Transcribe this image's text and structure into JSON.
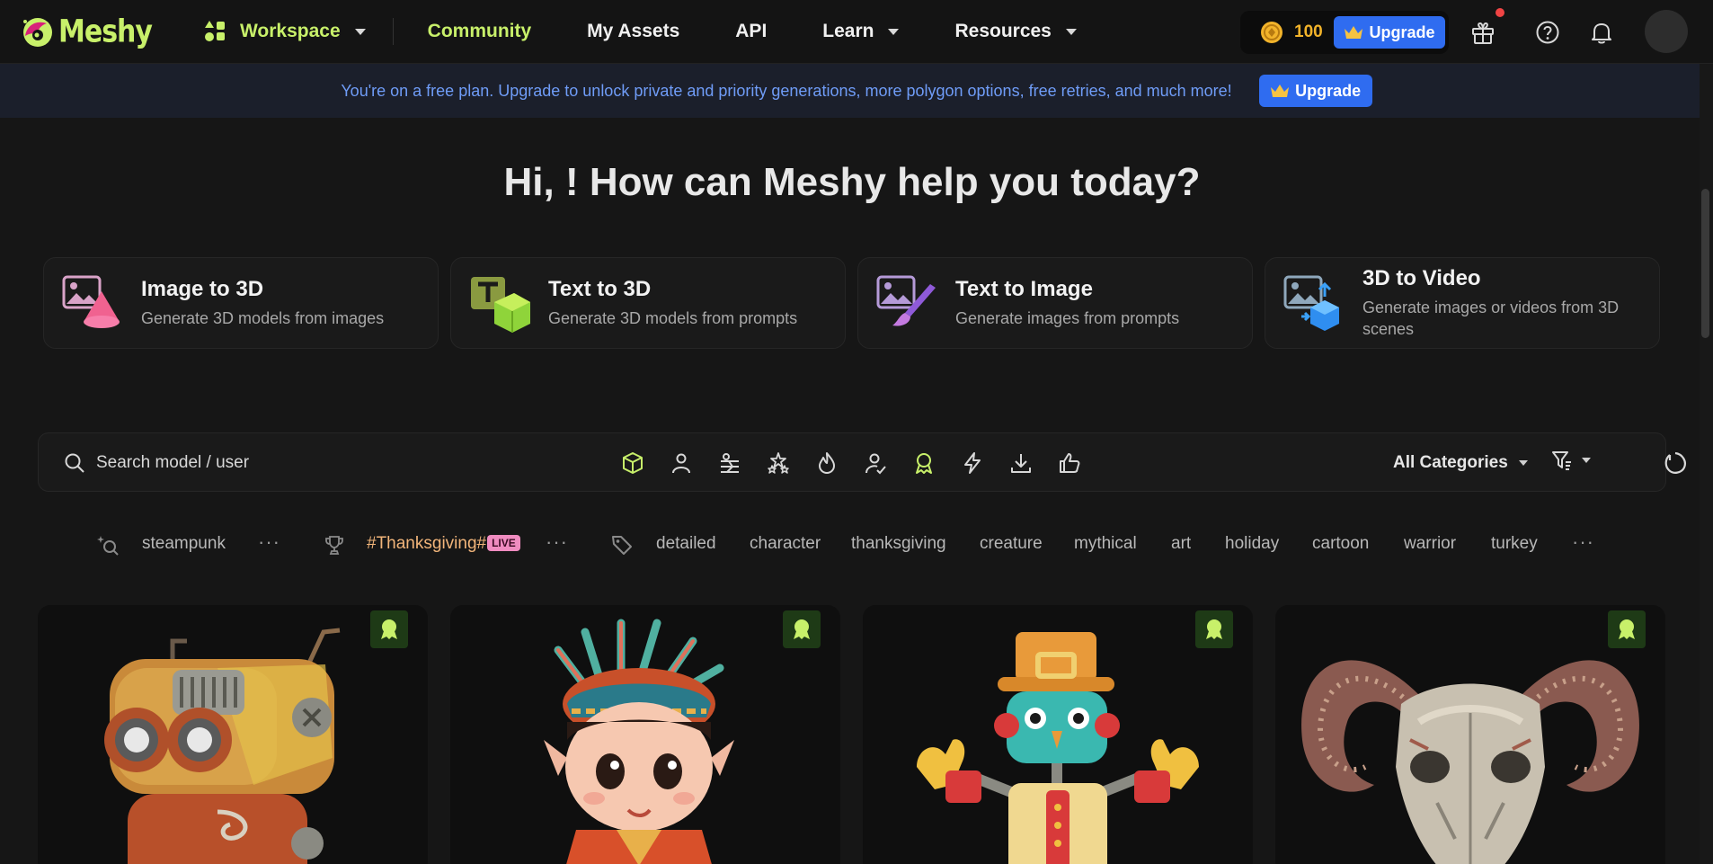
{
  "nav": {
    "logo_text": "Meshy",
    "workspace": "Workspace",
    "community": "Community",
    "my_assets": "My Assets",
    "api": "API",
    "learn": "Learn",
    "resources": "Resources",
    "credits": "100",
    "upgrade": "Upgrade"
  },
  "banner": {
    "text": "You're on a free plan. Upgrade to unlock private and priority generations, more polygon options, free retries, and much more!",
    "upgrade": "Upgrade"
  },
  "hero": {
    "title": "Hi, ! How can Meshy help you today?"
  },
  "tools": [
    {
      "title": "Image to 3D",
      "desc": "Generate 3D models from images"
    },
    {
      "title": "Text to 3D",
      "desc": "Generate 3D models from prompts"
    },
    {
      "title": "Text to Image",
      "desc": "Generate images from prompts"
    },
    {
      "title": "3D to Video",
      "desc": "Generate images or videos from 3D scenes"
    }
  ],
  "search": {
    "placeholder": "Search model / user",
    "category": "All Categories"
  },
  "filters": [
    {
      "icon": "cube-icon",
      "active": true
    },
    {
      "icon": "character-icon",
      "active": false
    },
    {
      "icon": "rigged-icon",
      "active": false
    },
    {
      "icon": "stars-icon",
      "active": false
    },
    {
      "icon": "fire-icon",
      "active": false
    },
    {
      "icon": "verified-user-icon",
      "active": false
    },
    {
      "icon": "award-icon",
      "active": true
    },
    {
      "icon": "lightning-icon",
      "active": false
    },
    {
      "icon": "download-icon",
      "active": false
    },
    {
      "icon": "thumbs-up-icon",
      "active": false
    }
  ],
  "tags": {
    "search_tag": "steampunk",
    "contest_tag": "#Thanksgiving#",
    "live": "LIVE",
    "popular": [
      "detailed",
      "character",
      "thanksgiving",
      "creature",
      "mythical",
      "art",
      "holiday",
      "cartoon",
      "warrior",
      "turkey"
    ]
  },
  "colors": {
    "accent_green": "#c8f06a",
    "upgrade_blue": "#2f6cf0",
    "banner_text": "#6f9cf7",
    "coin_gold": "#f2b32a"
  }
}
